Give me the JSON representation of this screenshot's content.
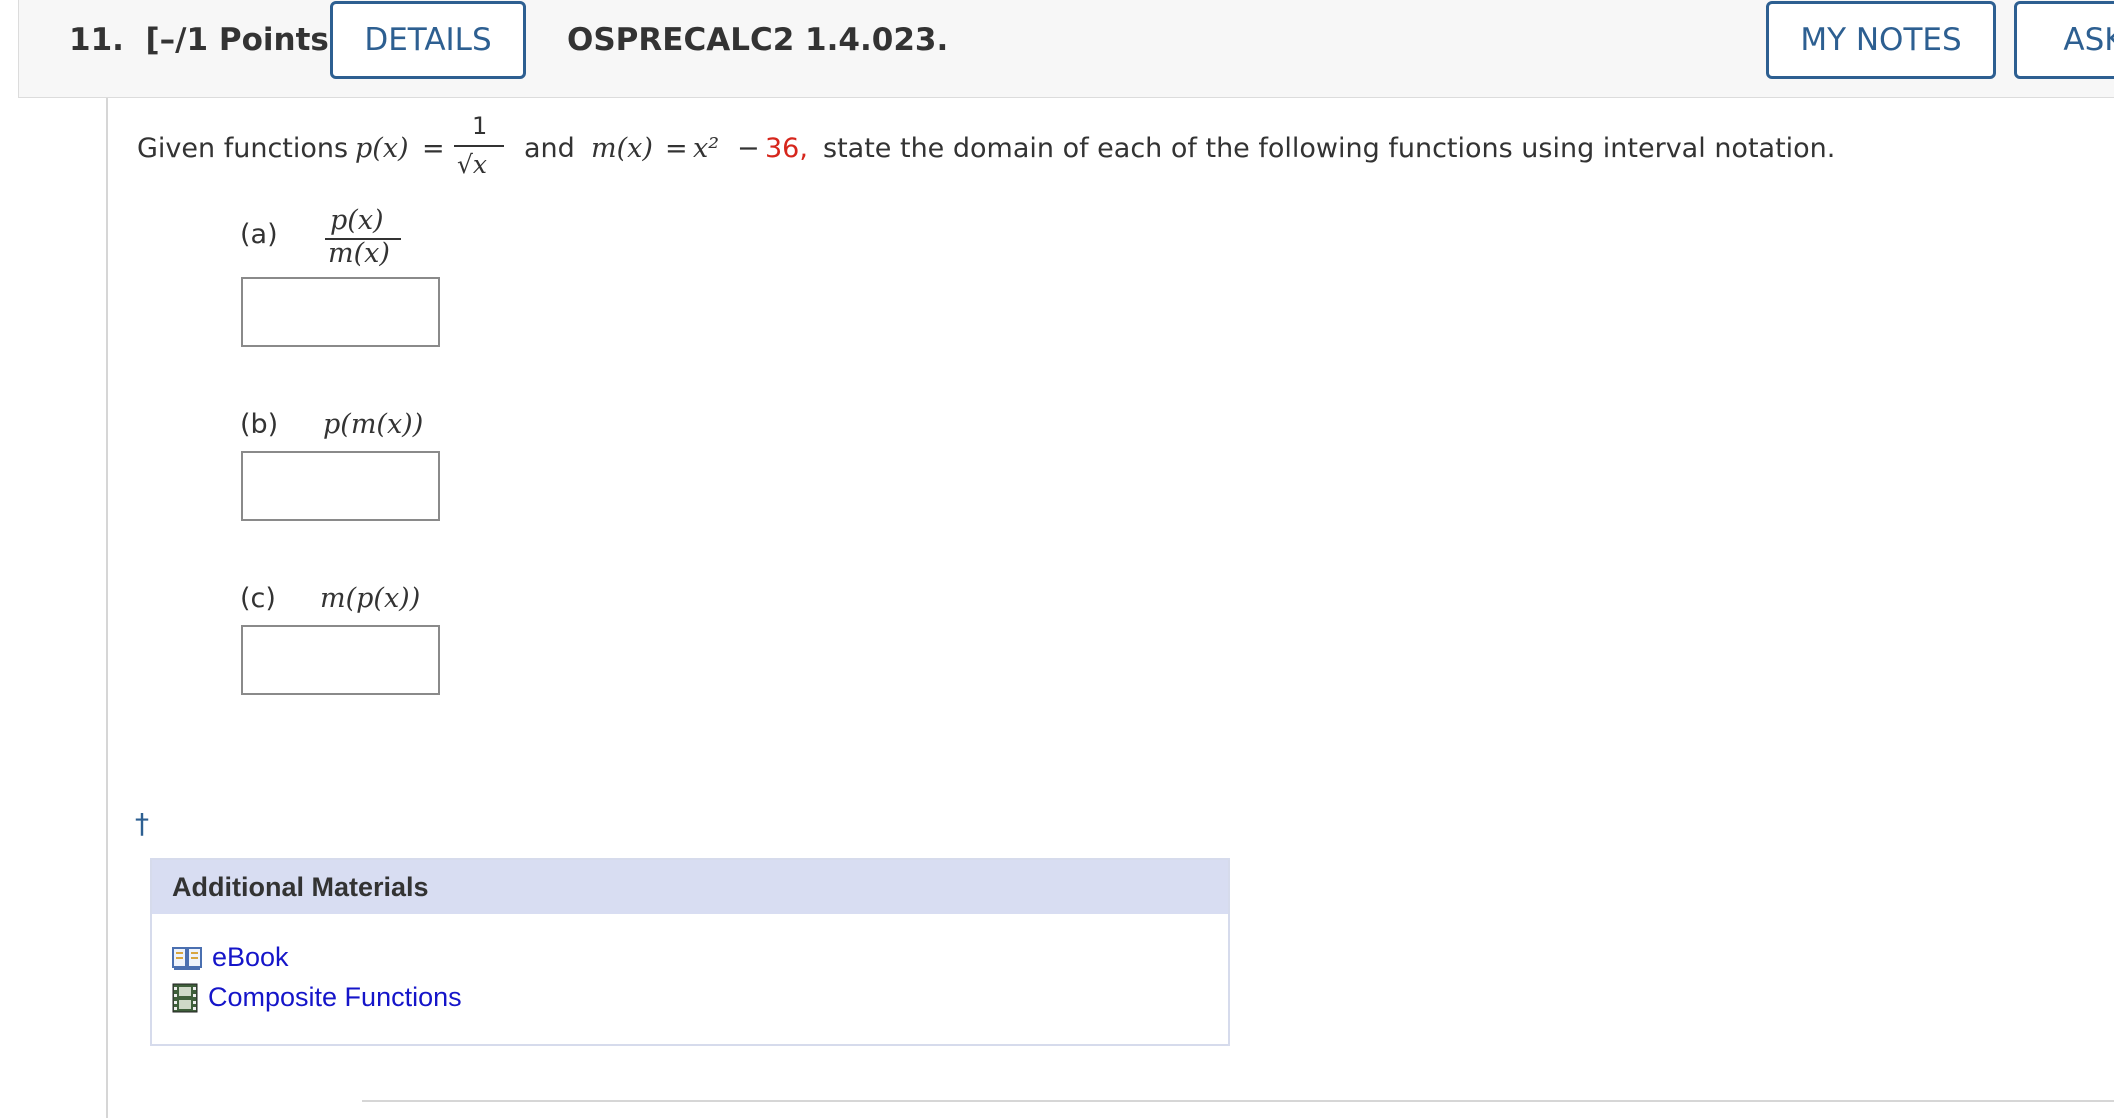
{
  "header": {
    "question_number": "11.",
    "points": "[–/1 Points]",
    "details_label": "DETAILS",
    "course_code": "OSPRECALC2 1.4.023.",
    "my_notes_label": "MY NOTES",
    "ask_label": "ASK"
  },
  "prompt": {
    "given": "Given functions",
    "p_of_x": "p(x)",
    "equals": "=",
    "frac_num": "1",
    "sqrt_x": "√x",
    "and": "and",
    "m_of_x": "m(x)",
    "equals2": "=",
    "x_squared": "x²",
    "minus": "−",
    "constant": "36,",
    "rest": "state the domain of each of the following functions using interval notation."
  },
  "parts": [
    {
      "label": "(a)",
      "numerator": "p(x)",
      "denominator": "m(x)",
      "answer": ""
    },
    {
      "label": "(b)",
      "expression": "p(m(x))",
      "answer": ""
    },
    {
      "label": "(c)",
      "expression": "m(p(x))",
      "answer": ""
    }
  ],
  "dagger": "†",
  "additional_materials": {
    "title": "Additional Materials",
    "items": [
      {
        "label": "eBook",
        "icon": "book-icon"
      },
      {
        "label": "Composite Functions",
        "icon": "film-icon"
      }
    ]
  }
}
